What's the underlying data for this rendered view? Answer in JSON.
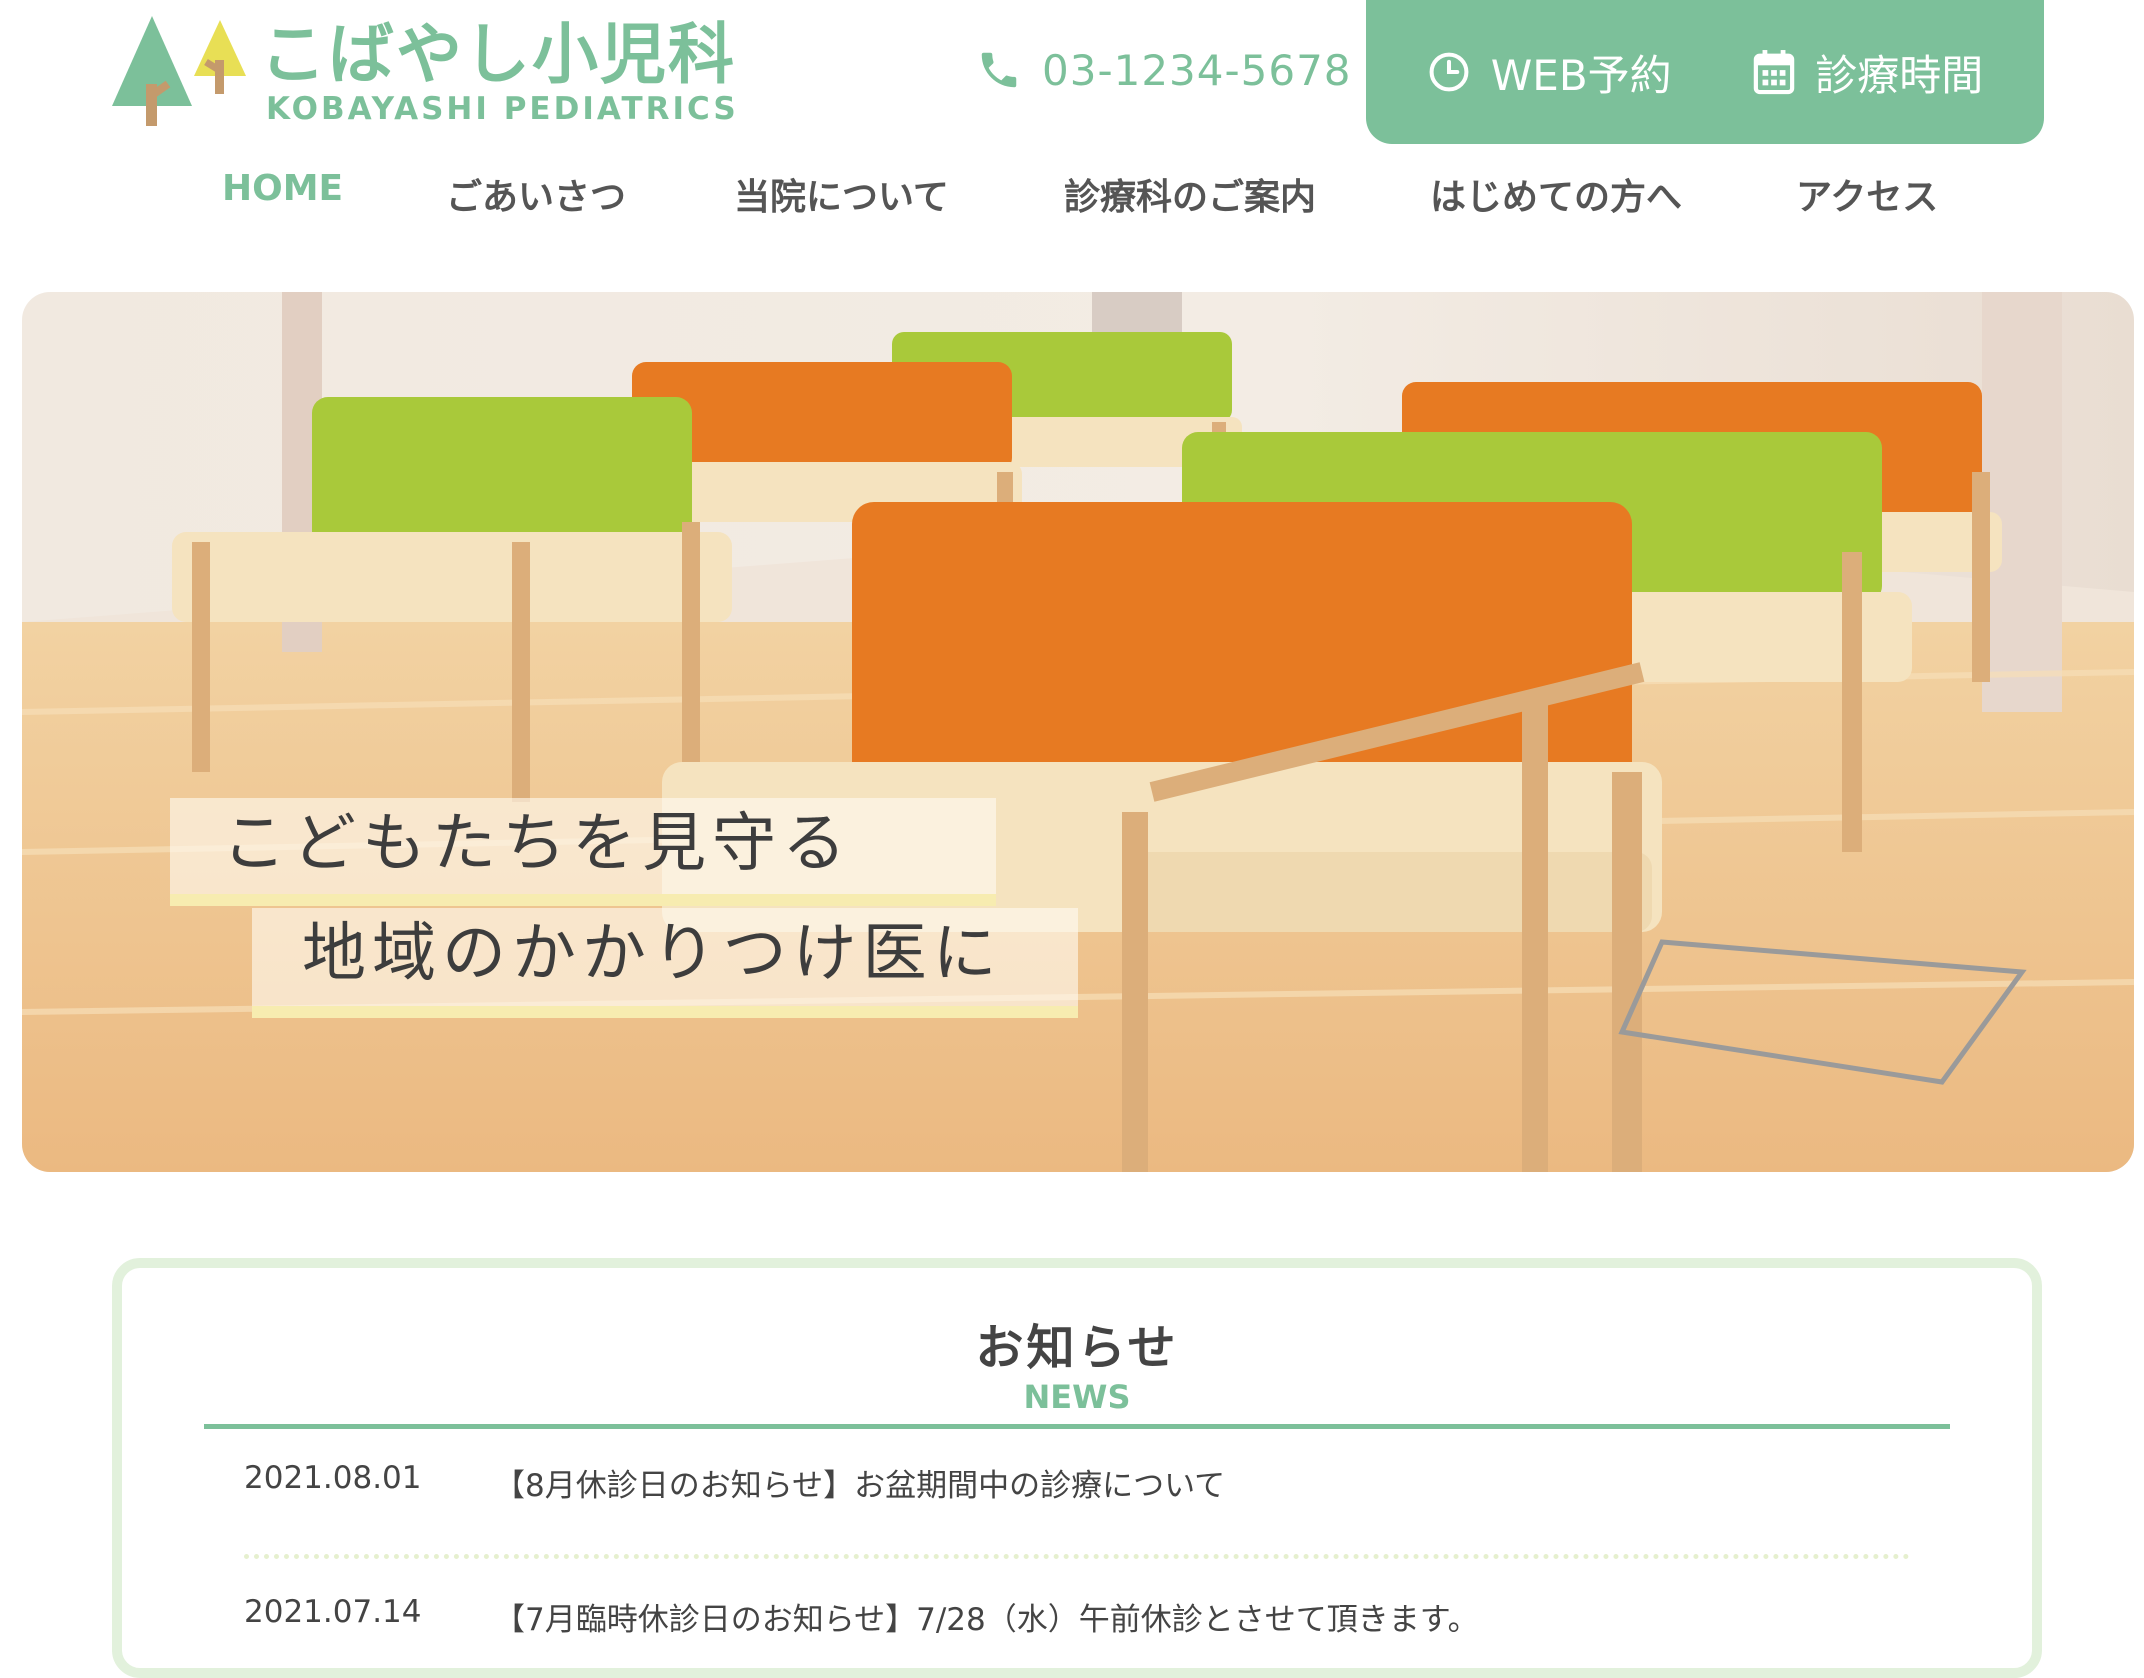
{
  "header": {
    "logo_title": "こばやし小児科",
    "logo_subtitle": "KOBAYASHI PEDIATRICS",
    "phone": "03-1234-5678",
    "cta": {
      "web_booking": "WEB予約",
      "hours": "診療時間"
    }
  },
  "nav": {
    "items": [
      {
        "label": "HOME"
      },
      {
        "label": "ごあいさつ"
      },
      {
        "label": "当院について"
      },
      {
        "label": "診療科のご案内"
      },
      {
        "label": "はじめての方へ"
      },
      {
        "label": "アクセス"
      }
    ]
  },
  "hero": {
    "caption_line1": "こどもたちを見守る",
    "caption_line2": "地域のかかりつけ医に"
  },
  "news": {
    "title": "お知らせ",
    "subtitle": "NEWS",
    "items": [
      {
        "date": "2021.08.01",
        "text": "【8月休診日のお知らせ】お盆期間中の診療について"
      },
      {
        "date": "2021.07.14",
        "text": "【7月臨時休診日のお知らせ】7/28（水）午前休診とさせて頂きます。"
      }
    ]
  },
  "colors": {
    "brand_green": "#7cc09a",
    "seat_green": "#a9c93a",
    "seat_orange": "#e77a22",
    "caption_underline": "#f7ecb0"
  }
}
